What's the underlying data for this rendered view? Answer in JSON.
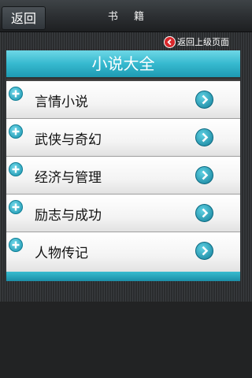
{
  "topbar": {
    "back_label": "返回",
    "title": "书 籍"
  },
  "return_link": {
    "label": "返回上级页面"
  },
  "section": {
    "title": "小说大全"
  },
  "list": {
    "items": [
      {
        "label": "言情小说"
      },
      {
        "label": "武侠与奇幻"
      },
      {
        "label": "经济与管理"
      },
      {
        "label": "励志与成功"
      },
      {
        "label": "人物传记"
      }
    ]
  },
  "icons": {
    "back": "back-button",
    "return": "left-chevron-icon",
    "plus": "plus-icon",
    "arrow": "chevron-right-icon"
  },
  "colors": {
    "accent": "#36b9cf",
    "return_red": "#d8272b",
    "bar_dark": "#2b2e31"
  }
}
